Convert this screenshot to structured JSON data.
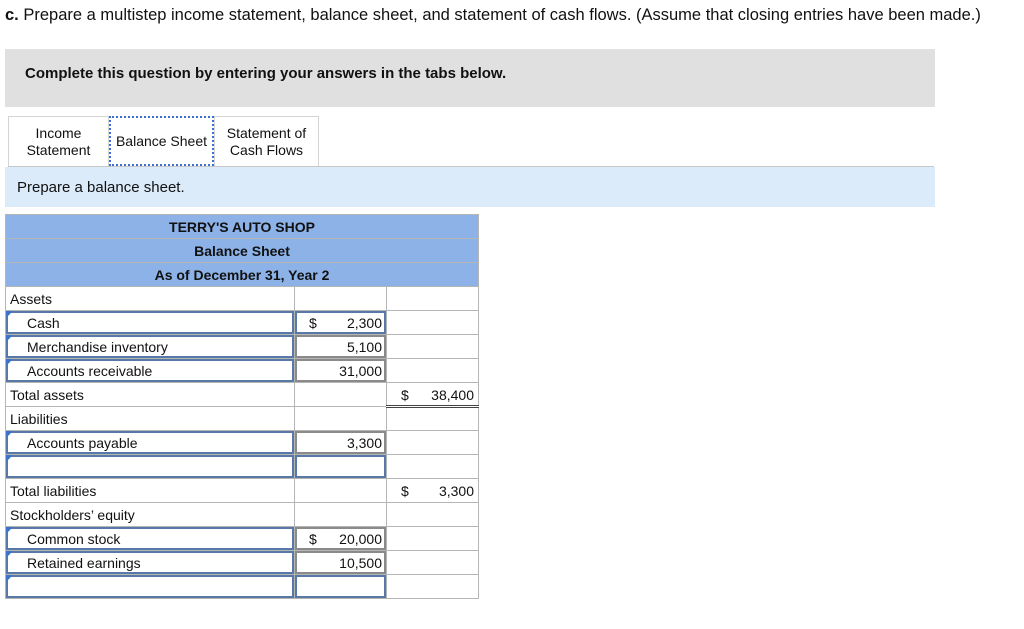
{
  "question": {
    "prefix": "c.",
    "text": " Prepare a multistep income statement, balance sheet, and statement of cash flows. (Assume that closing entries have been made.)"
  },
  "banner": "Complete this question by entering your answers in the tabs below.",
  "tabs": [
    {
      "line1": "Income",
      "line2": "Statement"
    },
    {
      "line1": "Balance Sheet",
      "line2": ""
    },
    {
      "line1": "Statement of",
      "line2": "Cash Flows"
    }
  ],
  "instruction": "Prepare a balance sheet.",
  "sheet": {
    "company": "TERRY'S AUTO SHOP",
    "title": "Balance Sheet",
    "date": "As of December 31, Year 2",
    "assets_label": "Assets",
    "cash": {
      "label": "Cash",
      "dollar": "$",
      "value": "2,300"
    },
    "inventory": {
      "label": "Merchandise inventory",
      "value": "5,100"
    },
    "receivable": {
      "label": "Accounts receivable",
      "value": "31,000"
    },
    "total_assets": {
      "label": "Total assets",
      "dollar": "$",
      "value": "38,400"
    },
    "liabilities_label": "Liabilities",
    "payable": {
      "label": "Accounts payable",
      "value": "3,300"
    },
    "total_liabilities": {
      "label": "Total liabilities",
      "dollar": "$",
      "value": "3,300"
    },
    "equity_label": "Stockholders’ equity",
    "common_stock": {
      "label": "Common stock",
      "dollar": "$",
      "value": "20,000"
    },
    "retained": {
      "label": "Retained earnings",
      "value": "10,500"
    }
  }
}
